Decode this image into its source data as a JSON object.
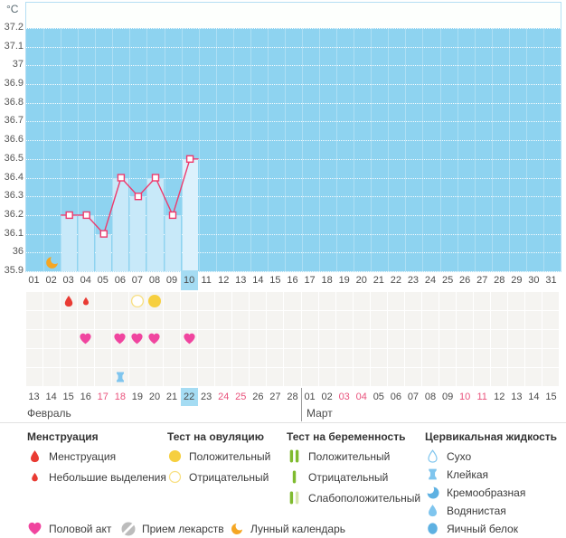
{
  "chart_data": {
    "type": "line",
    "unit": "°C",
    "y_ticks": [
      "37.2",
      "37.1",
      "37",
      "36.9",
      "36.8",
      "36.7",
      "36.6",
      "36.5",
      "36.4",
      "36.3",
      "36.2",
      "36.1",
      "36",
      "35.9"
    ],
    "ylim": [
      35.9,
      37.2
    ],
    "x_cycle_days": [
      "01",
      "02",
      "03",
      "04",
      "05",
      "06",
      "07",
      "08",
      "09",
      "10",
      "11",
      "12",
      "13",
      "14",
      "15",
      "16",
      "17",
      "18",
      "19",
      "20",
      "21",
      "22",
      "23",
      "24",
      "25",
      "26",
      "27",
      "28",
      "29",
      "30",
      "31"
    ],
    "selected_cycle_day": "10",
    "temperature_series": {
      "days": [
        3,
        4,
        5,
        6,
        7,
        8,
        9,
        10
      ],
      "values": [
        36.2,
        36.2,
        36.1,
        36.4,
        36.3,
        36.4,
        36.2,
        36.5
      ]
    },
    "events": {
      "lunar_calendar": [
        2
      ],
      "menstruation": [
        {
          "day": 3,
          "kind": "full"
        },
        {
          "day": 4,
          "kind": "spotting"
        }
      ],
      "ovulation_tests": [
        {
          "day": 7,
          "result": "negative"
        },
        {
          "day": 8,
          "result": "positive"
        }
      ],
      "pregnancy_tests": [],
      "intercourse": [
        4,
        6,
        7,
        8,
        10
      ],
      "medication": [],
      "cervical_fluid": [
        {
          "day": 6,
          "kind": "sticky"
        }
      ]
    },
    "calendar": {
      "months": [
        {
          "name": "Февраль",
          "dates": [
            "13",
            "14",
            "15",
            "16",
            "17",
            "18",
            "19",
            "20",
            "21",
            "22",
            "23",
            "24",
            "25",
            "26",
            "27",
            "28"
          ],
          "weekend_dates": [
            "17",
            "18",
            "24",
            "25"
          ],
          "selected_date": "22"
        },
        {
          "name": "Март",
          "dates": [
            "01",
            "02",
            "03",
            "04",
            "05",
            "06",
            "07",
            "08",
            "09",
            "10",
            "11",
            "12",
            "13",
            "14",
            "15"
          ],
          "weekend_dates": [
            "03",
            "04",
            "10",
            "11"
          ],
          "selected_date": ""
        }
      ]
    }
  },
  "legend": {
    "sections": [
      {
        "title": "Менструация",
        "items": [
          {
            "icon": "drop-large-icon",
            "label": "Менструация"
          },
          {
            "icon": "drop-small-icon",
            "label": "Небольшие выделения"
          }
        ]
      },
      {
        "title": "Тест на овуляцию",
        "items": [
          {
            "icon": "circle-filled-icon",
            "label": "Положительный"
          },
          {
            "icon": "circle-outline-icon",
            "label": "Отрицательный"
          }
        ]
      },
      {
        "title": "Тест на беременность",
        "items": [
          {
            "icon": "two-bars-icon",
            "label": "Положительный"
          },
          {
            "icon": "one-bar-icon",
            "label": "Отрицательный"
          },
          {
            "icon": "weak-bars-icon",
            "label": "Слабоположительный"
          }
        ]
      },
      {
        "title": "Цервикальная жидкость",
        "items": [
          {
            "icon": "droplet-outline-icon",
            "label": "Сухо"
          },
          {
            "icon": "sticky-icon",
            "label": "Клейкая"
          },
          {
            "icon": "creamy-icon",
            "label": "Кремообразная"
          },
          {
            "icon": "watery-icon",
            "label": "Водянистая"
          },
          {
            "icon": "eggwhite-icon",
            "label": "Яичный белок"
          }
        ]
      }
    ],
    "footer": [
      {
        "icon": "heart-icon",
        "label": "Половой акт"
      },
      {
        "icon": "pill-icon",
        "label": "Прием лекарств"
      },
      {
        "icon": "moon-icon",
        "label": "Лунный календарь"
      }
    ]
  },
  "colors": {
    "chart_bg": "#8ed3f0",
    "bar": "#c8e9f9",
    "bar_selected": "#dcf1fc",
    "line": "#ee3a6d",
    "day_highlight": "#a5dcf3",
    "weekend_text": "#e9517b",
    "day_text": "#4b4b4b",
    "menstruation": "#e93b33",
    "heart": "#f0459f",
    "ovulation_positive": "#f6cf3f",
    "ovulation_negative": "#f8df80",
    "pregnancy_positive": "#7fbb2f",
    "pregnancy_weak": "#d7e6ab",
    "fluid_light": "#7fc5ee",
    "fluid_dark": "#5eb1e2",
    "moon": "#f5a623",
    "pill": "#bcbcbc"
  }
}
